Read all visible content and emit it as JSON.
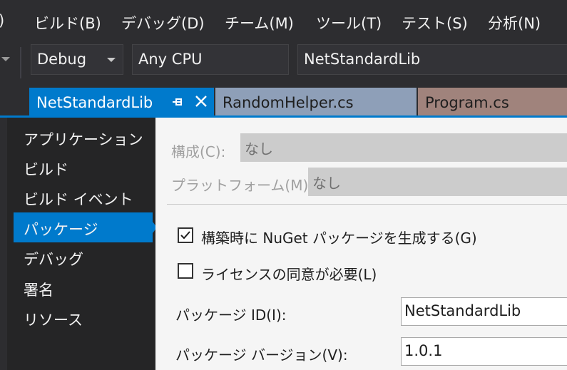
{
  "menu": {
    "items": [
      ")",
      "ビルド(B)",
      "デバッグ(D)",
      "チーム(M)",
      "ツール(T)",
      "テスト(S)",
      "分析(N)"
    ]
  },
  "toolbar": {
    "config_value": "Debug",
    "platform_value": "Any CPU",
    "project_value": "NetStandardLib"
  },
  "tabs": [
    {
      "label": "NetStandardLib",
      "active": true
    },
    {
      "label": "RandomHelper.cs",
      "active": false
    },
    {
      "label": "Program.cs",
      "active": false
    }
  ],
  "sidebar": {
    "items": [
      {
        "label": "アプリケーション"
      },
      {
        "label": "ビルド"
      },
      {
        "label": "ビルド イベント"
      },
      {
        "label": "パッケージ"
      },
      {
        "label": "デバッグ"
      },
      {
        "label": "署名"
      },
      {
        "label": "リソース"
      }
    ],
    "selected": "パッケージ"
  },
  "page": {
    "config_label": "構成(C):",
    "config_value": "なし",
    "platform_label": "プラットフォーム(M):",
    "platform_value": "なし",
    "generate_package": {
      "label": "構築時に NuGet パッケージを生成する(G)",
      "checked": true
    },
    "require_license": {
      "label": "ライセンスの同意が必要(L)",
      "checked": false
    },
    "package_id_label": "パッケージ ID(I):",
    "package_id_value": "NetStandardLib",
    "package_version_label": "パッケージ バージョン(V):",
    "package_version_value": "1.0.1"
  },
  "colors": {
    "accent": "#007acc",
    "chrome_bg": "#2d2d30",
    "nav_bg": "#252526",
    "content_bg": "#f5f5f5"
  }
}
